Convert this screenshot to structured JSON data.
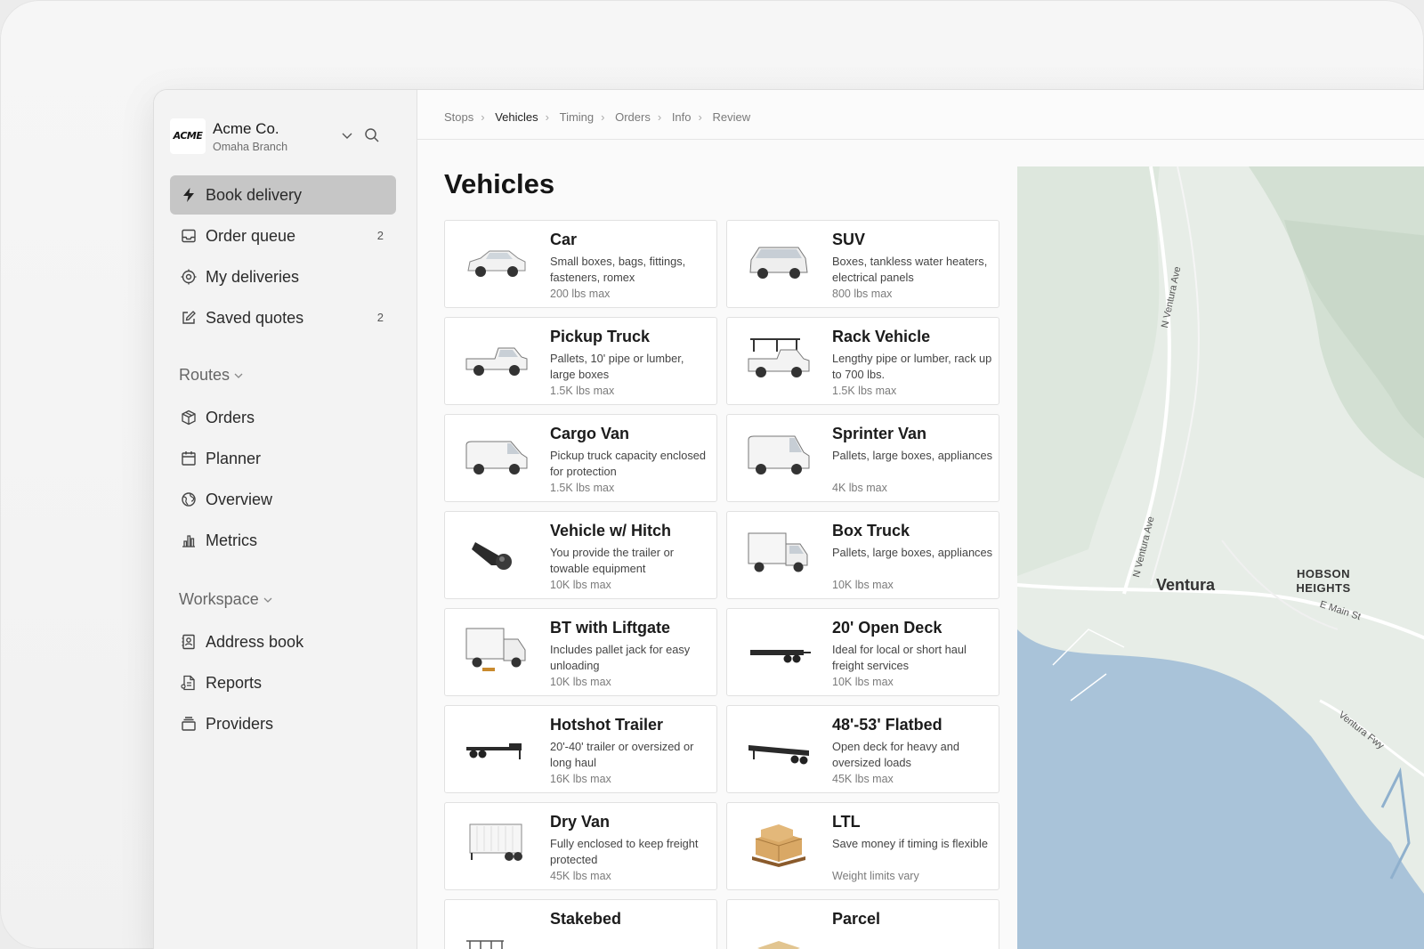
{
  "org": {
    "logo": "ACME",
    "name": "Acme Co.",
    "branch": "Omaha Branch"
  },
  "nav": {
    "primary": [
      {
        "label": "Book delivery",
        "icon": "bolt-icon",
        "count": ""
      },
      {
        "label": "Order queue",
        "icon": "inbox-icon",
        "count": "2"
      },
      {
        "label": "My deliveries",
        "icon": "target-icon",
        "count": ""
      },
      {
        "label": "Saved quotes",
        "icon": "edit-icon",
        "count": "2"
      }
    ],
    "routes_label": "Routes",
    "routes": [
      {
        "label": "Orders",
        "icon": "box-icon"
      },
      {
        "label": "Planner",
        "icon": "calendar-icon"
      },
      {
        "label": "Overview",
        "icon": "globe-icon"
      },
      {
        "label": "Metrics",
        "icon": "bar-chart-icon"
      }
    ],
    "workspace_label": "Workspace",
    "workspace": [
      {
        "label": "Address book",
        "icon": "contact-book-icon"
      },
      {
        "label": "Reports",
        "icon": "report-icon"
      },
      {
        "label": "Providers",
        "icon": "stack-icon"
      }
    ]
  },
  "breadcrumbs": [
    "Stops",
    "Vehicles",
    "Timing",
    "Orders",
    "Info",
    "Review"
  ],
  "current_step": "Vehicles",
  "page_title": "Vehicles",
  "vehicles": [
    {
      "name": "Car",
      "desc": "Small boxes, bags, fittings, fasteners, romex",
      "max": "200 lbs max",
      "icon": "car-icon"
    },
    {
      "name": "SUV",
      "desc": "Boxes, tankless water heaters, electrical panels",
      "max": "800 lbs max",
      "icon": "suv-icon"
    },
    {
      "name": "Pickup Truck",
      "desc": "Pallets, 10' pipe or lumber, large boxes",
      "max": "1.5K lbs max",
      "icon": "pickup-truck-icon"
    },
    {
      "name": "Rack Vehicle",
      "desc": "Lengthy pipe or lumber, rack up to 700 lbs.",
      "max": "1.5K lbs max",
      "icon": "rack-truck-icon"
    },
    {
      "name": "Cargo Van",
      "desc": "Pickup truck capacity enclosed for protection",
      "max": "1.5K lbs max",
      "icon": "cargo-van-icon"
    },
    {
      "name": "Sprinter Van",
      "desc": "Pallets, large boxes, appliances",
      "max": "4K lbs max",
      "icon": "sprinter-van-icon"
    },
    {
      "name": "Vehicle w/ Hitch",
      "desc": "You provide the trailer or towable equipment",
      "max": "10K lbs max",
      "icon": "hitch-icon"
    },
    {
      "name": "Box Truck",
      "desc": "Pallets, large boxes, appliances",
      "max": "10K lbs max",
      "icon": "box-truck-icon"
    },
    {
      "name": "BT with Liftgate",
      "desc": "Includes pallet jack for easy unloading",
      "max": "10K lbs max",
      "icon": "liftgate-truck-icon"
    },
    {
      "name": "20' Open Deck",
      "desc": "Ideal for local or short haul freight services",
      "max": "10K lbs max",
      "icon": "open-deck-trailer-icon"
    },
    {
      "name": "Hotshot Trailer",
      "desc": "20'-40' trailer or oversized or long haul",
      "max": "16K lbs max",
      "icon": "hotshot-trailer-icon"
    },
    {
      "name": "48'-53' Flatbed",
      "desc": "Open deck for heavy and oversized loads",
      "max": "45K lbs max",
      "icon": "flatbed-trailer-icon"
    },
    {
      "name": "Dry Van",
      "desc": "Fully enclosed to keep freight protected",
      "max": "45K lbs max",
      "icon": "dry-van-trailer-icon"
    },
    {
      "name": "LTL",
      "desc": "Save money if timing is flexible",
      "max": "Weight limits vary",
      "icon": "pallet-boxes-icon"
    },
    {
      "name": "Stakebed",
      "desc": "",
      "max": "",
      "icon": "stakebed-icon"
    },
    {
      "name": "Parcel",
      "desc": "",
      "max": "",
      "icon": "parcel-icon"
    }
  ],
  "map": {
    "labels": {
      "city": "Ventura",
      "district": "HOBSON HEIGHTS",
      "street_1": "N Ventura Ave",
      "street_2": "N Ventura Ave",
      "street_3": "E Main St",
      "street_4": "Ventura Fwy"
    },
    "colors": {
      "land": "#e6ece6",
      "water": "#a9c3d9",
      "park": "#d2dfd2"
    }
  }
}
